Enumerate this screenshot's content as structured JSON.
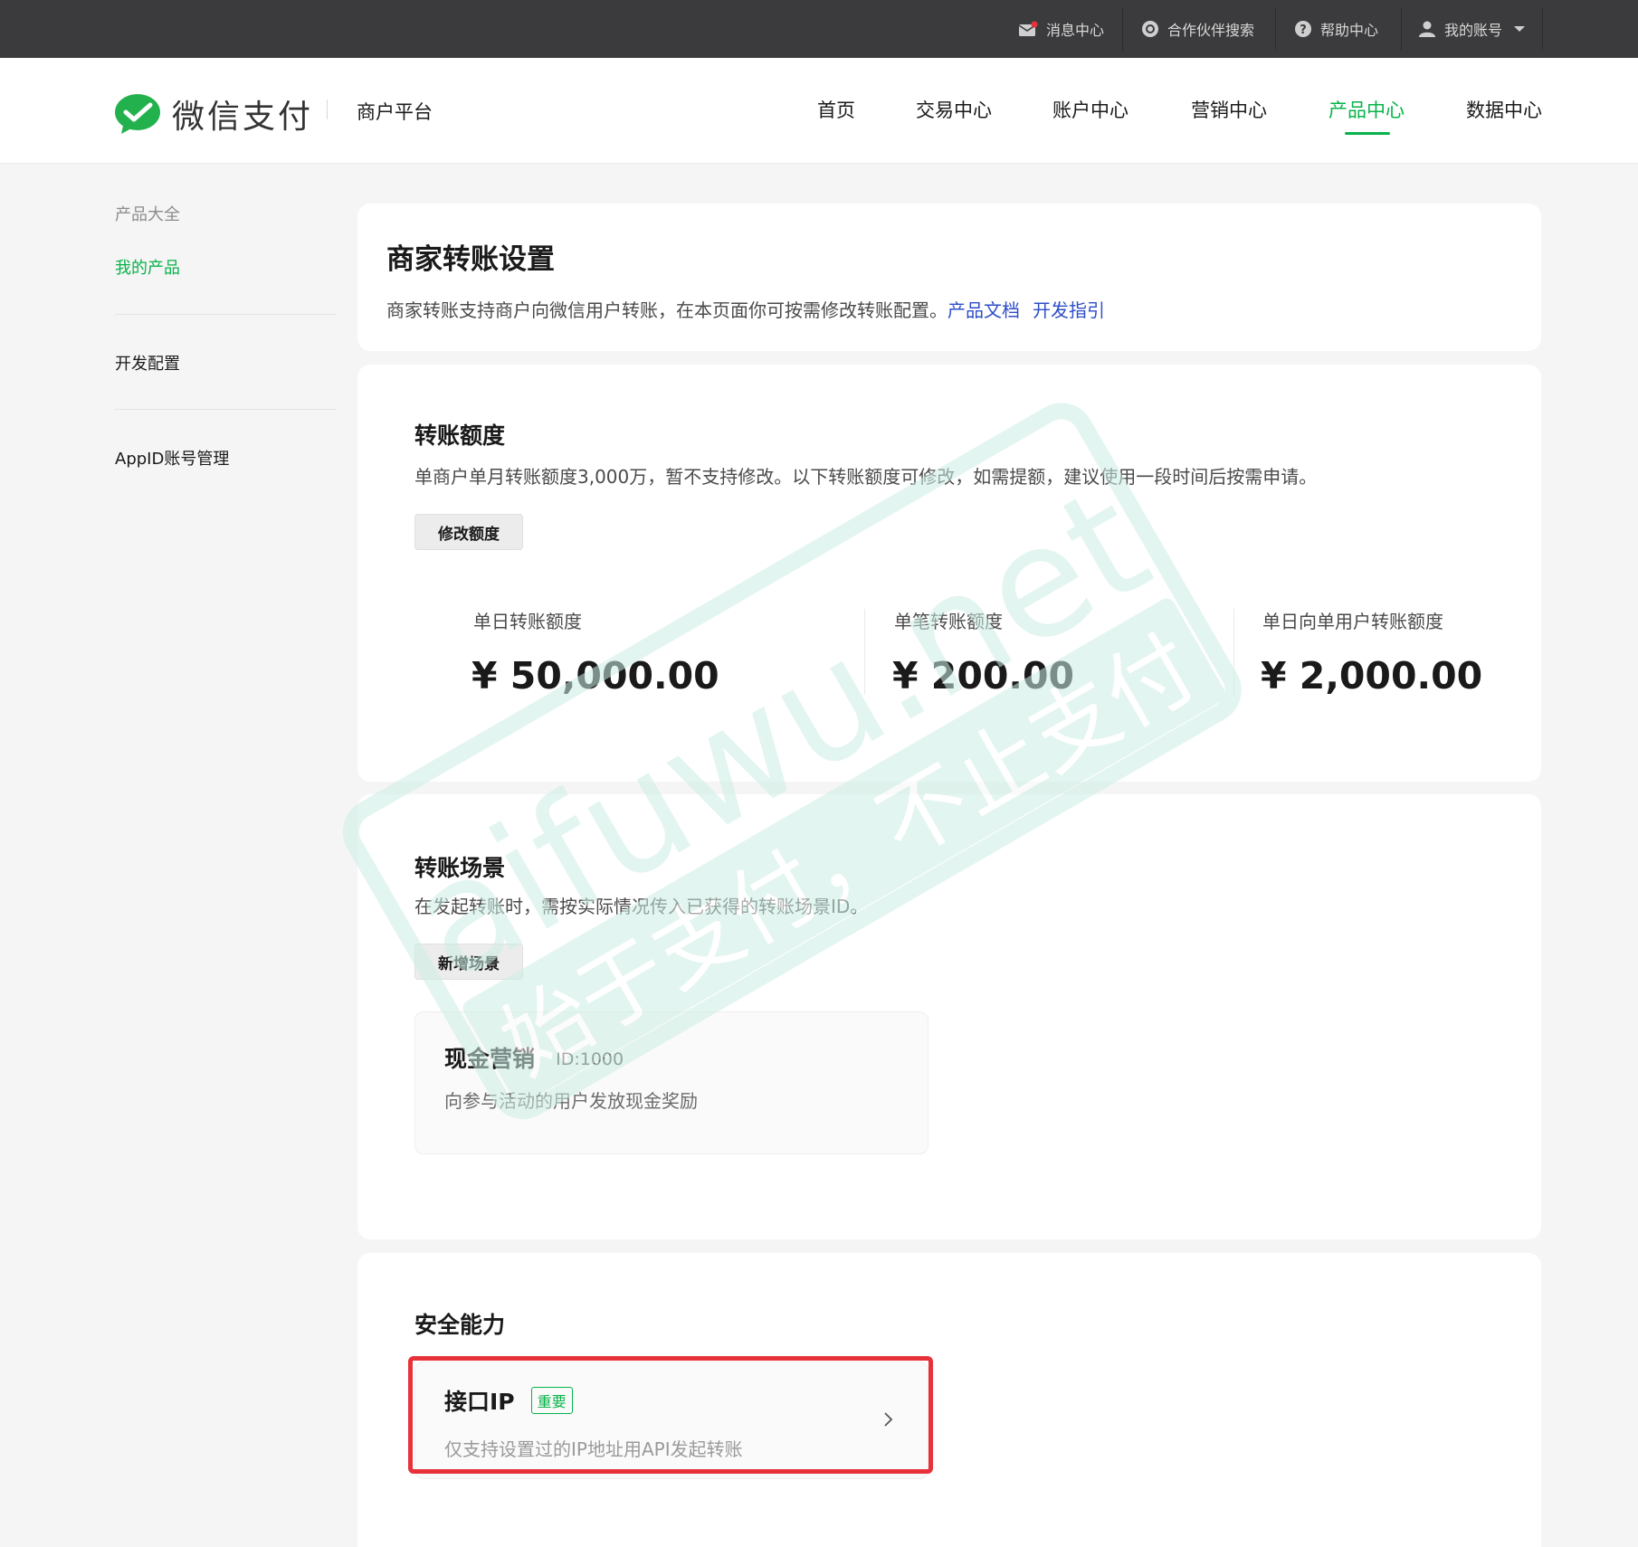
{
  "topbar": {
    "message_center": "消息中心",
    "partner_search": "合作伙伴搜索",
    "help_center": "帮助中心",
    "my_account": "我的账号"
  },
  "header": {
    "logo_text": "微信支付",
    "platform": "商户平台",
    "nav": [
      "首页",
      "交易中心",
      "账户中心",
      "营销中心",
      "产品中心",
      "数据中心"
    ],
    "active_nav": "产品中心"
  },
  "sidebar": {
    "items": [
      "产品大全",
      "我的产品",
      "开发配置",
      "AppID账号管理"
    ],
    "active": "我的产品"
  },
  "intro": {
    "title": "商家转账设置",
    "desc": "商家转账支持商户向微信用户转账，在本页面你可按需修改转账配置。",
    "link_doc": "产品文档",
    "link_guide": "开发指引"
  },
  "quota": {
    "title": "转账额度",
    "desc": "单商户单月转账额度3,000万，暂不支持修改。以下转账额度可修改，如需提额，建议使用一段时间后按需申请。",
    "modify_button": "修改额度",
    "items": [
      {
        "label": "单日转账额度",
        "value": "¥ 50,000.00"
      },
      {
        "label": "单笔转账额度",
        "value": "¥ 200.00"
      },
      {
        "label": "单日向单用户转账额度",
        "value": "¥ 2,000.00"
      }
    ]
  },
  "scene": {
    "title": "转账场景",
    "desc": "在发起转账时，需按实际情况传入已获得的转账场景ID。",
    "add_button": "新增场景",
    "card": {
      "name": "现金营销",
      "id": "ID:1000",
      "desc": "向参与活动的用户发放现金奖励"
    }
  },
  "security": {
    "title": "安全能力",
    "ip": {
      "title": "接口IP",
      "tag": "重要",
      "desc": "仅支持设置过的IP地址用API发起转账"
    }
  },
  "watermark": {
    "main": "aifuwu.net",
    "sub": "始于支付，不止支付"
  },
  "colors": {
    "accent": "#07b34a",
    "link": "#2d4ec7",
    "highlight": "#e8323a",
    "topbar": "#3b3b3d"
  }
}
